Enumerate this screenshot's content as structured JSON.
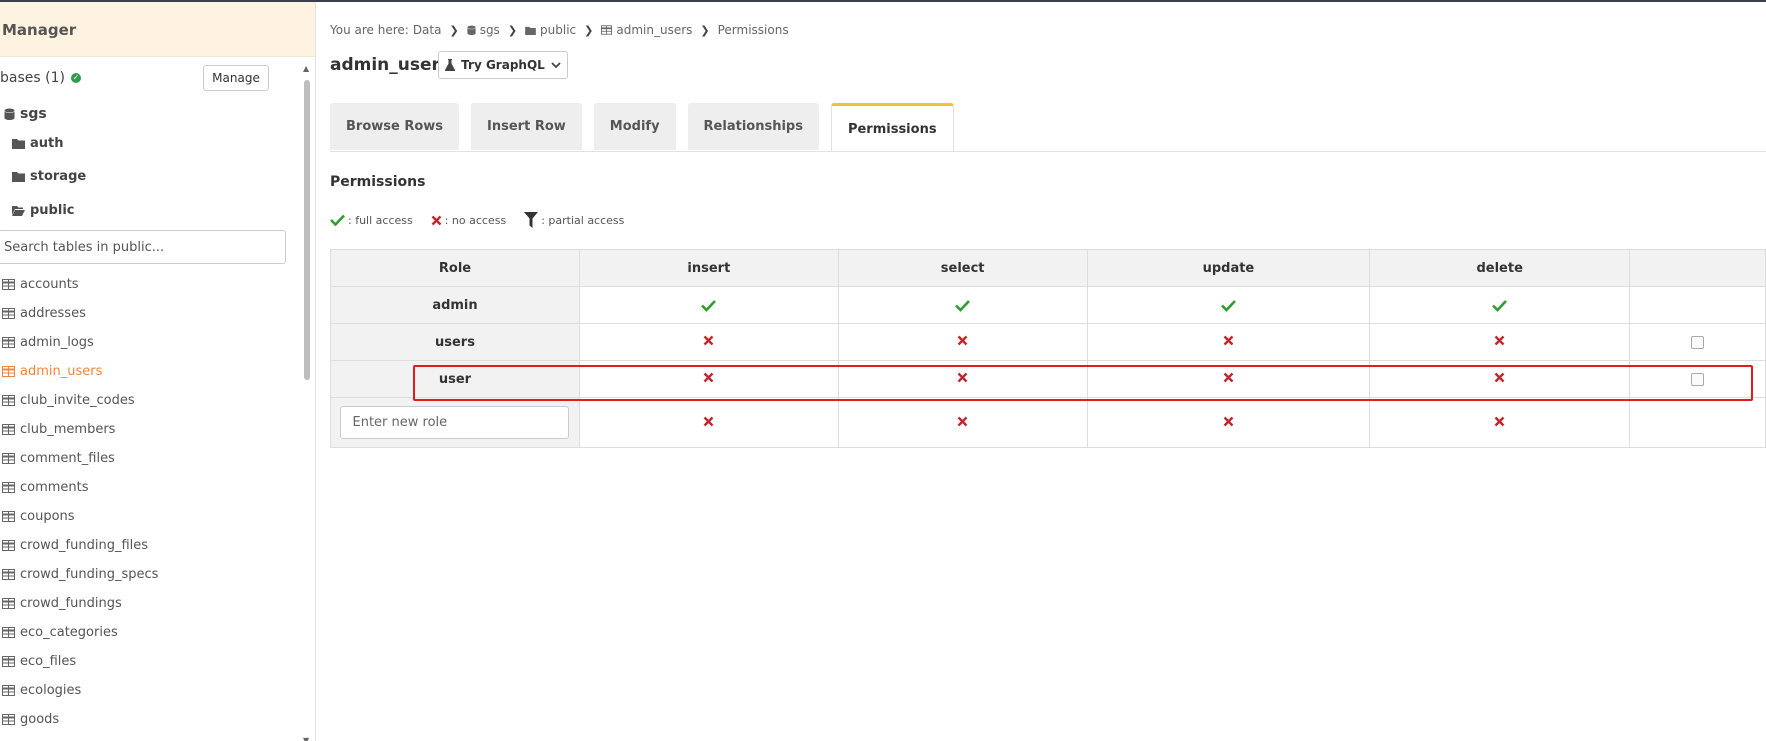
{
  "sidebar": {
    "title": "Manager",
    "databases_label": "bases (1)",
    "manage_label": "Manage",
    "db_name": "sgs",
    "schemas": [
      "auth",
      "storage",
      "public"
    ],
    "search_placeholder": "Search tables in public...",
    "tables": [
      "accounts",
      "addresses",
      "admin_logs",
      "admin_users",
      "club_invite_codes",
      "club_members",
      "comment_files",
      "comments",
      "coupons",
      "crowd_funding_files",
      "crowd_funding_specs",
      "crowd_fundings",
      "eco_categories",
      "eco_files",
      "ecologies",
      "goods"
    ],
    "active_table": "admin_users"
  },
  "breadcrumb": {
    "prefix": "You are here:",
    "items": [
      "Data",
      "sgs",
      "public",
      "admin_users",
      "Permissions"
    ]
  },
  "page": {
    "title": "admin_users",
    "graphql_label": "Try GraphQL"
  },
  "tabs": [
    "Browse Rows",
    "Insert Row",
    "Modify",
    "Relationships",
    "Permissions"
  ],
  "active_tab": "Permissions",
  "permissions": {
    "heading": "Permissions",
    "legend": {
      "full": ": full access",
      "none": ": no access",
      "partial": ": partial access"
    },
    "columns": [
      "Role",
      "insert",
      "select",
      "update",
      "delete"
    ],
    "rows": [
      {
        "role": "admin",
        "access": [
          "full",
          "full",
          "full",
          "full"
        ]
      },
      {
        "role": "users",
        "access": [
          "none",
          "none",
          "none",
          "none"
        ]
      },
      {
        "role": "user",
        "access": [
          "none",
          "none",
          "none",
          "none"
        ]
      }
    ],
    "new_role_placeholder": "Enter new role",
    "new_role_access": [
      "none",
      "none",
      "none",
      "none"
    ]
  },
  "colors": {
    "accent": "#f0863c",
    "full": "#2e9e2e",
    "none": "#c0272d",
    "highlight": "#e31b1b",
    "tab_active_border": "#f4c430"
  }
}
